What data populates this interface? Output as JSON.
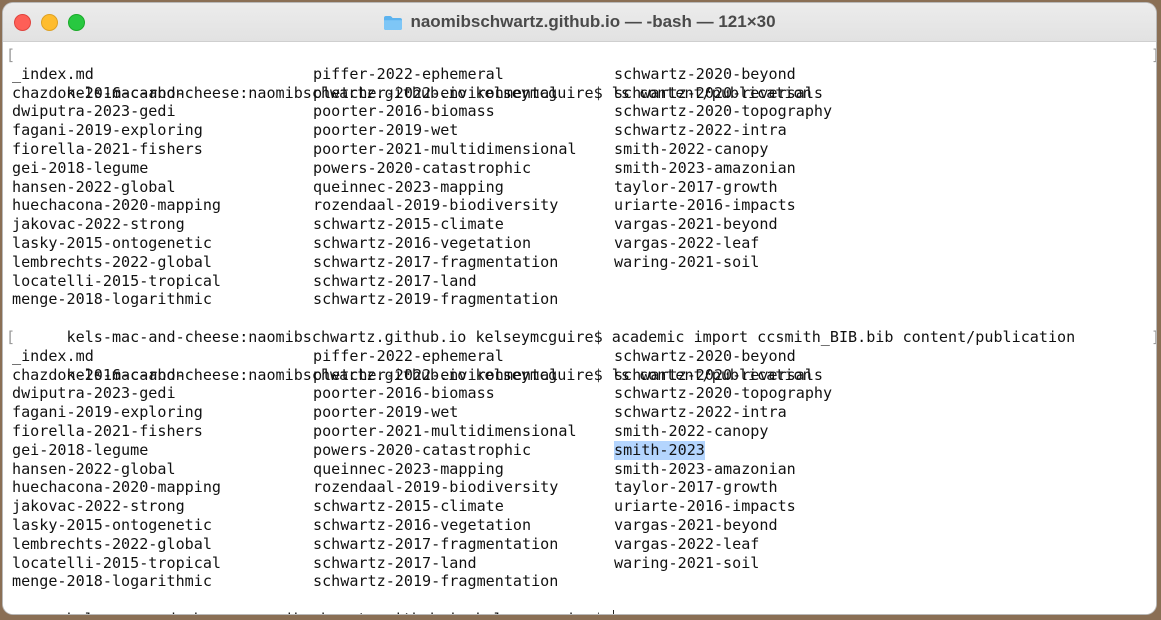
{
  "window": {
    "title": "naomibschwartz.github.io — -bash — 121×30"
  },
  "terminal": {
    "prompt": "kels-mac-and-cheese:naomibschwartz.github.io kelseymcguire$",
    "command1": "ls content/publication",
    "command2": "academic import ccsmith_BIB.bib content/publication",
    "command3": "ls content/publication",
    "listing1": [
      [
        "_index.md",
        "piffer-2022-ephemeral",
        "schwartz-2020-beyond"
      ],
      [
        "chazdon-2016-carbon",
        "pletcher-2022-environmental",
        "schwartz-2020-reversals"
      ],
      [
        "dwiputra-2023-gedi",
        "poorter-2016-biomass",
        "schwartz-2020-topography"
      ],
      [
        "fagani-2019-exploring",
        "poorter-2019-wet",
        "schwartz-2022-intra"
      ],
      [
        "fiorella-2021-fishers",
        "poorter-2021-multidimensional",
        "smith-2022-canopy"
      ],
      [
        "gei-2018-legume",
        "powers-2020-catastrophic",
        "smith-2023-amazonian"
      ],
      [
        "hansen-2022-global",
        "queinnec-2023-mapping",
        "taylor-2017-growth"
      ],
      [
        "huechacona-2020-mapping",
        "rozendaal-2019-biodiversity",
        "uriarte-2016-impacts"
      ],
      [
        "jakovac-2022-strong",
        "schwartz-2015-climate",
        "vargas-2021-beyond"
      ],
      [
        "lasky-2015-ontogenetic",
        "schwartz-2016-vegetation",
        "vargas-2022-leaf"
      ],
      [
        "lembrechts-2022-global",
        "schwartz-2017-fragmentation",
        "waring-2021-soil"
      ],
      [
        "locatelli-2015-tropical",
        "schwartz-2017-land",
        ""
      ],
      [
        "menge-2018-logarithmic",
        "schwartz-2019-fragmentation",
        ""
      ]
    ],
    "listing2": [
      [
        "_index.md",
        "piffer-2022-ephemeral",
        "schwartz-2020-beyond"
      ],
      [
        "chazdon-2016-carbon",
        "pletcher-2022-environmental",
        "schwartz-2020-reversals"
      ],
      [
        "dwiputra-2023-gedi",
        "poorter-2016-biomass",
        "schwartz-2020-topography"
      ],
      [
        "fagani-2019-exploring",
        "poorter-2019-wet",
        "schwartz-2022-intra"
      ],
      [
        "fiorella-2021-fishers",
        "poorter-2021-multidimensional",
        "smith-2022-canopy"
      ],
      [
        "gei-2018-legume",
        "powers-2020-catastrophic",
        "smith-2023"
      ],
      [
        "hansen-2022-global",
        "queinnec-2023-mapping",
        "smith-2023-amazonian"
      ],
      [
        "huechacona-2020-mapping",
        "rozendaal-2019-biodiversity",
        "taylor-2017-growth"
      ],
      [
        "jakovac-2022-strong",
        "schwartz-2015-climate",
        "uriarte-2016-impacts"
      ],
      [
        "lasky-2015-ontogenetic",
        "schwartz-2016-vegetation",
        "vargas-2021-beyond"
      ],
      [
        "lembrechts-2022-global",
        "schwartz-2017-fragmentation",
        "vargas-2022-leaf"
      ],
      [
        "locatelli-2015-tropical",
        "schwartz-2017-land",
        "waring-2021-soil"
      ],
      [
        "menge-2018-logarithmic",
        "schwartz-2019-fragmentation",
        ""
      ]
    ],
    "highlighted_entry": "smith-2023",
    "highlight_color": "#b4d5fe"
  }
}
